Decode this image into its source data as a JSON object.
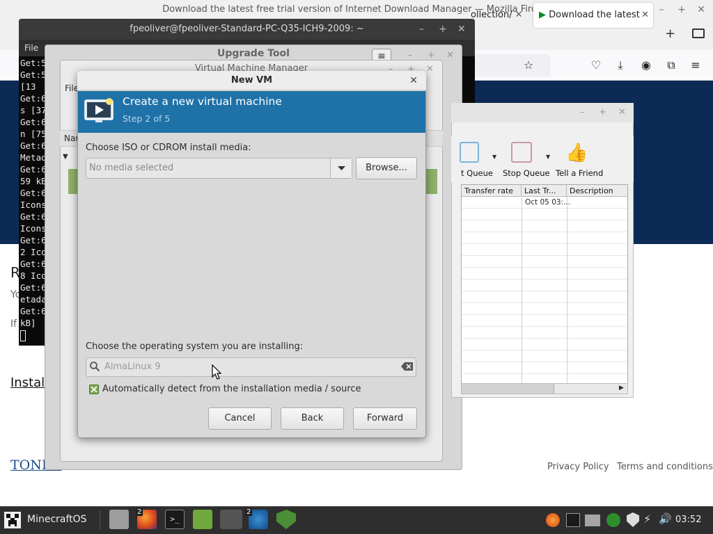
{
  "firefox": {
    "window_title": "Download the latest free trial version of Internet Download Manager — Mozilla Firefox",
    "tab_collection": "ollection/",
    "tab_active": "Download the latest",
    "footer_privacy": "Privacy Policy",
    "footer_terms": "Terms and conditions",
    "page_link": "Instal",
    "page_letter_r": "R",
    "page_text_yo": "Yo",
    "page_text_if": "If",
    "logo_text": "TONEC"
  },
  "terminal": {
    "title": "fpeoliver@fpeoliver-Standard-PC-Q35-ICH9-2009: ~",
    "menu_file": "File",
    "lines": [
      "Get:5",
      "Get:5",
      " [13",
      "Get:6",
      "s [37",
      "Get:6",
      "n [75",
      "Get:6",
      "Metad",
      "Get:6",
      "59 kB",
      "Get:6",
      "Icons",
      "Get:6",
      "Icons",
      "Get:6",
      "2 Ico",
      "Get:6",
      "8 Ico",
      "Get:6",
      "etada",
      "Get:6",
      "kB]"
    ]
  },
  "upgrade_tool": {
    "title": "Upgrade Tool"
  },
  "virt_manager": {
    "title": "Virtual Machine Manager",
    "menu_file": "File",
    "col_name": "Nar"
  },
  "idm": {
    "toolbar": [
      "t Queue",
      "Stop Queue",
      "Tell a Friend"
    ],
    "columns": [
      "Transfer rate",
      "Last Tr...",
      "Description"
    ],
    "row1_last": "Oct 05 03:..."
  },
  "new_vm": {
    "title": "New VM",
    "heading": "Create a new virtual machine",
    "step": "Step 2 of 5",
    "media_label": "Choose ISO or CDROM install media:",
    "media_value": "No media selected",
    "browse_label": "Browse...",
    "os_label": "Choose the operating system you are installing:",
    "os_placeholder": "AlmaLinux 9",
    "auto_detect_label": "Automatically detect from the installation media / source",
    "auto_detect_checked": true,
    "cancel_label": "Cancel",
    "back_label": "Back",
    "forward_label": "Forward"
  },
  "taskbar": {
    "menu_label": "MinecraftOS",
    "firefox_badge": "2",
    "idm_badge": "2",
    "clock": "03:52"
  },
  "colors": {
    "banner": "#1f72a8",
    "taskbar": "#2e2e2e",
    "hero": "#0c2a55",
    "check": "#7ca64f"
  }
}
